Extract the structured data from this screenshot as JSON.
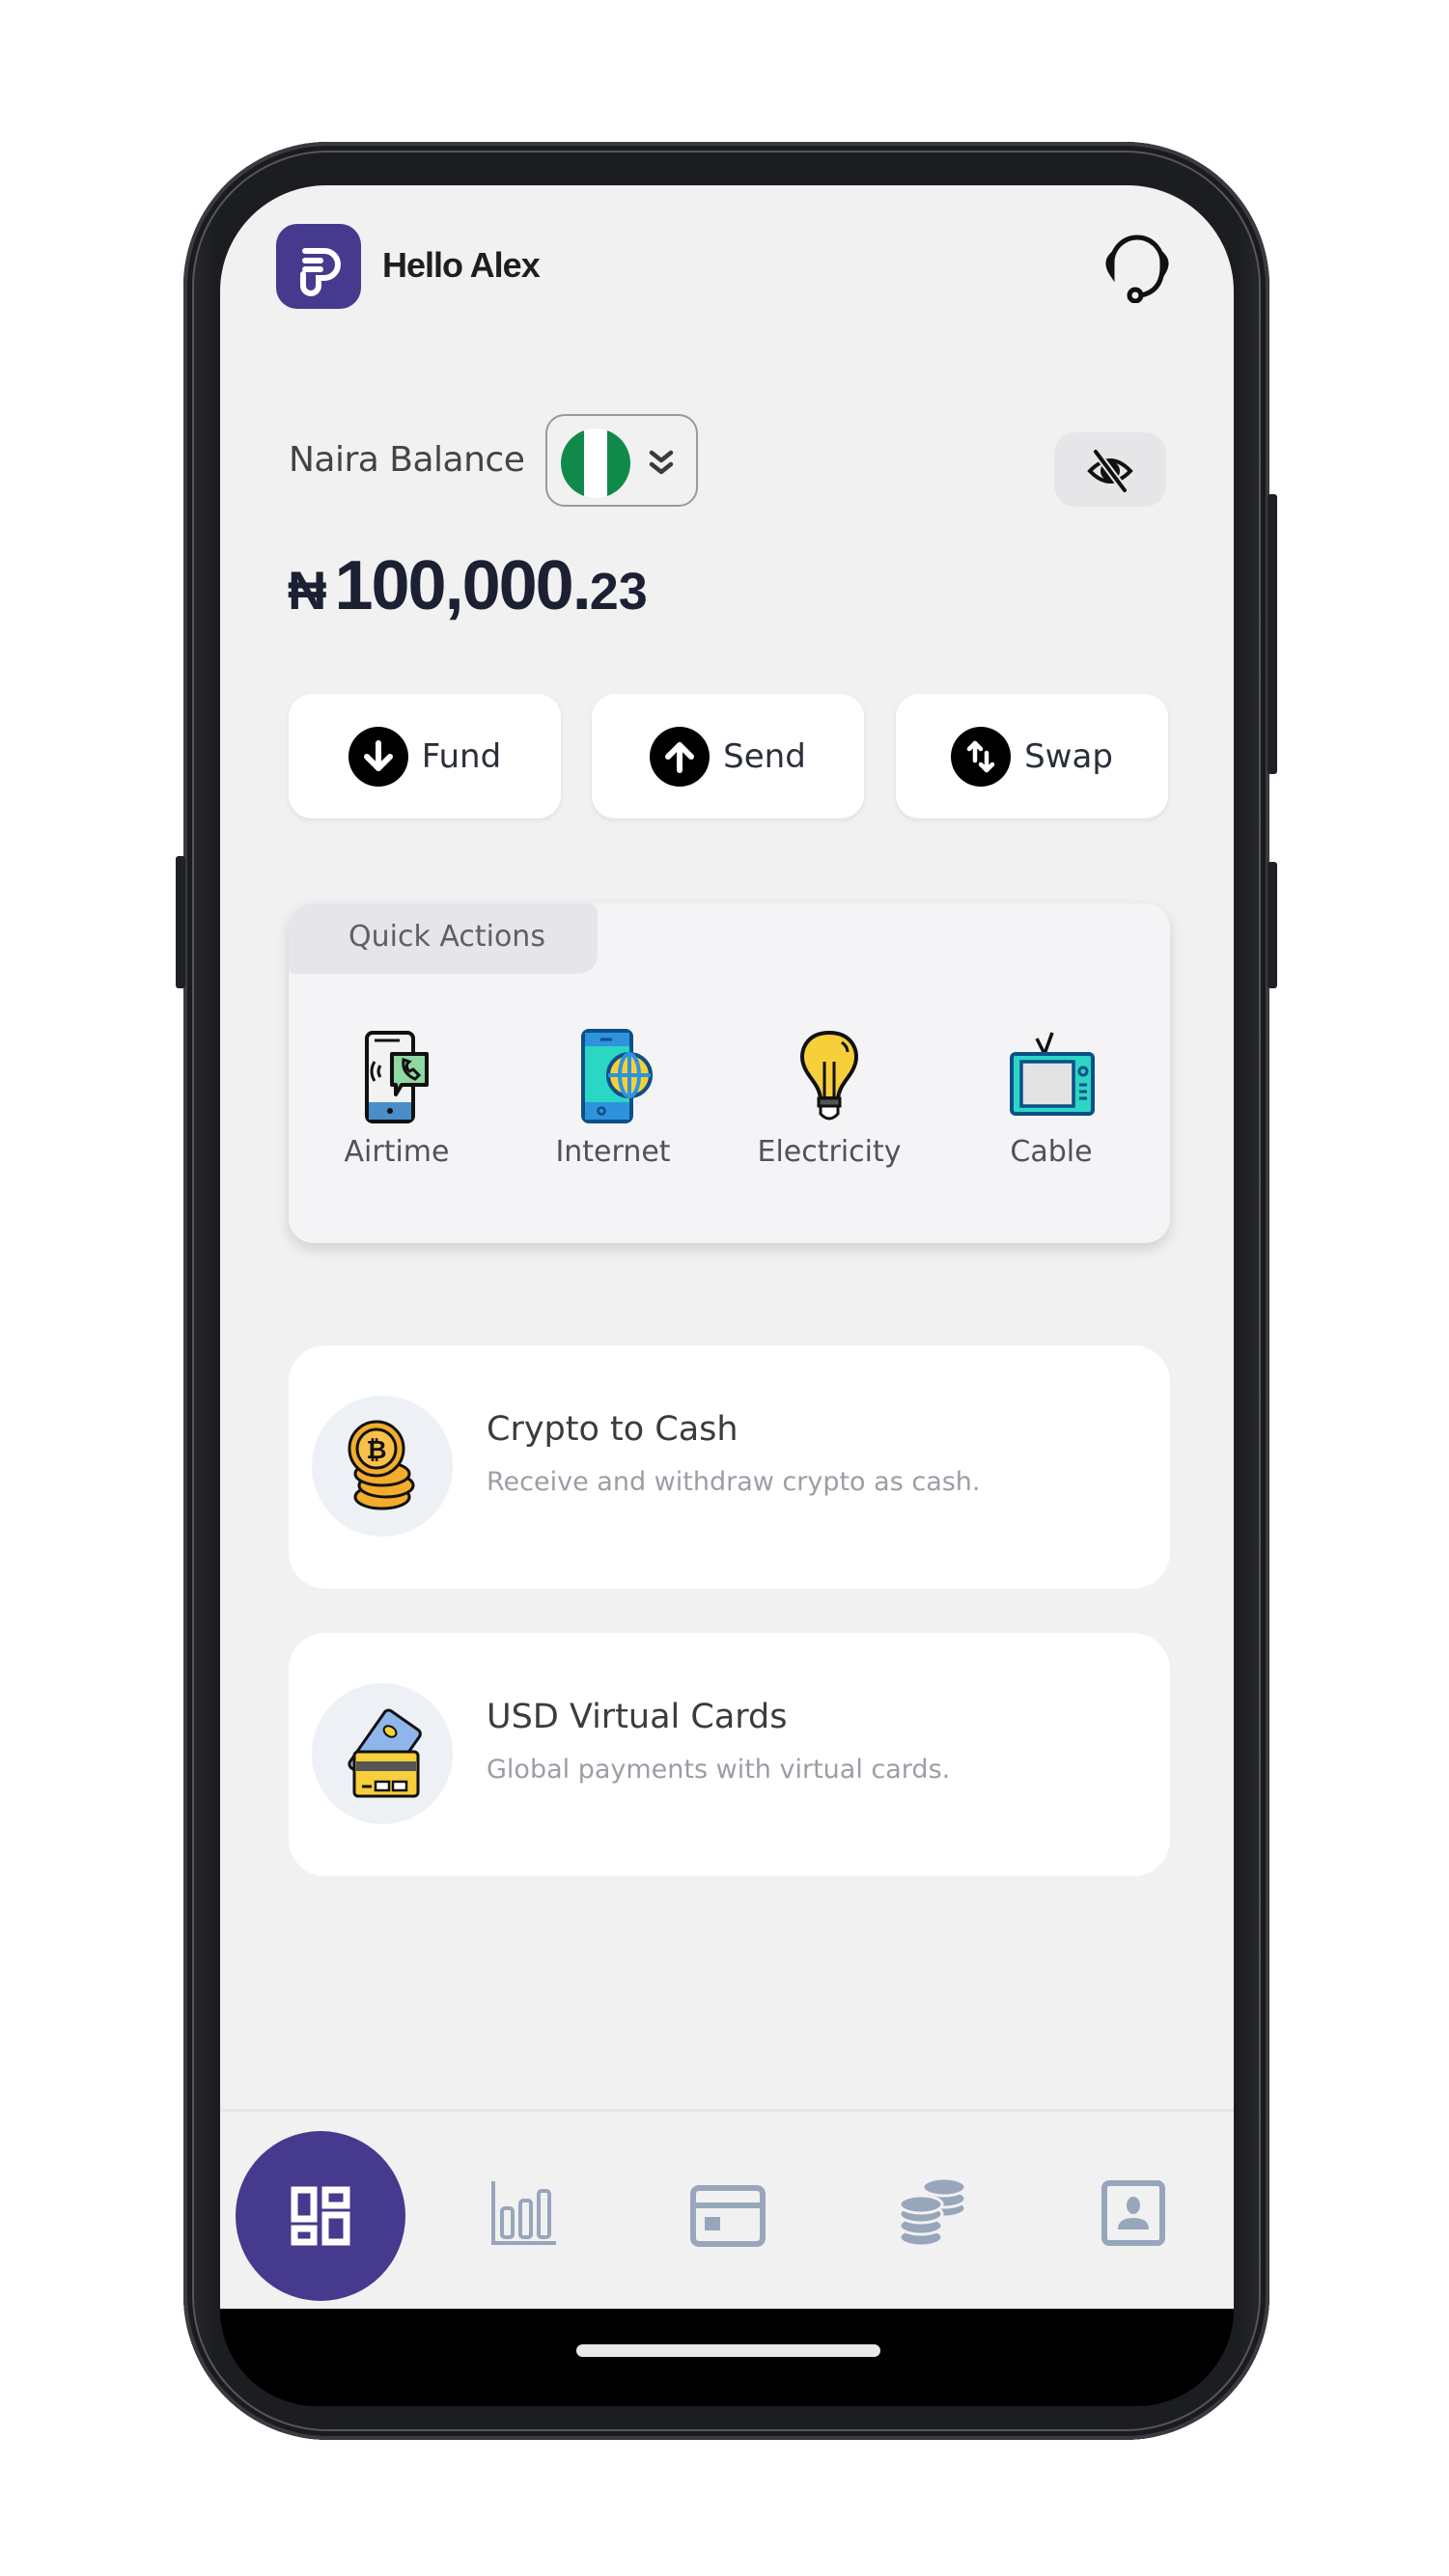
{
  "header": {
    "greeting": "Hello Alex",
    "logo_icon": "app-logo",
    "support_icon": "headset-icon"
  },
  "balance": {
    "label": "Naira Balance",
    "selected_currency": "NGN",
    "currency_flag": "nigeria-flag",
    "currency_symbol": "₦",
    "amount_main": "100,000.",
    "amount_decimal": "23",
    "visibility_icon": "eye-off-icon"
  },
  "actions": [
    {
      "label": "Fund",
      "icon": "arrow-down-circle-icon"
    },
    {
      "label": "Send",
      "icon": "arrow-up-circle-icon"
    },
    {
      "label": "Swap",
      "icon": "swap-vertical-icon"
    }
  ],
  "quick_actions": {
    "title": "Quick Actions",
    "items": [
      {
        "label": "Airtime",
        "icon": "phone-call-icon"
      },
      {
        "label": "Internet",
        "icon": "phone-globe-icon"
      },
      {
        "label": "Electricity",
        "icon": "lightbulb-icon"
      },
      {
        "label": "Cable",
        "icon": "tv-icon"
      }
    ]
  },
  "features": [
    {
      "title": "Crypto to Cash",
      "subtitle": "Receive and withdraw crypto as cash.",
      "icon": "bitcoin-coins-icon"
    },
    {
      "title": "USD Virtual Cards",
      "subtitle": "Global payments with virtual cards.",
      "icon": "credit-cards-icon"
    }
  ],
  "bottom_nav": {
    "active": "dashboard",
    "items": [
      {
        "id": "dashboard",
        "icon": "dashboard-icon"
      },
      {
        "id": "analytics",
        "icon": "bar-chart-icon"
      },
      {
        "id": "cards",
        "icon": "card-icon"
      },
      {
        "id": "crypto",
        "icon": "coins-icon"
      },
      {
        "id": "profile",
        "icon": "profile-icon"
      }
    ]
  },
  "colors": {
    "brand": "#463a8e",
    "background": "#f1f1f1",
    "nav_inactive": "#98a6bc",
    "nigeria_green": "#108a4a"
  }
}
